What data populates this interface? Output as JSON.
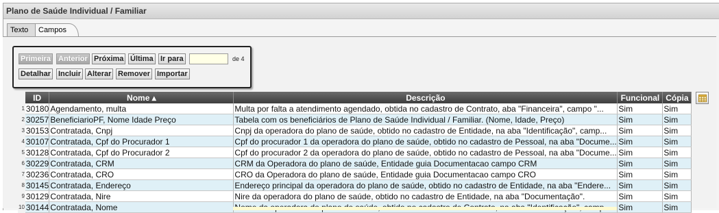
{
  "panel": {
    "title": "Plano de Saúde Individual / Familiar"
  },
  "tabs": [
    {
      "label": "Texto"
    },
    {
      "label": "Campos"
    }
  ],
  "navigation": {
    "first": "Primeira",
    "prev": "Anterior",
    "next": "Próxima",
    "last": "Última",
    "goto": "Ir para",
    "page_input_value": "",
    "page_suffix": "de 4",
    "detail": "Detalhar",
    "include": "Incluir",
    "edit": "Alterar",
    "remove": "Remover",
    "import": "Importar"
  },
  "grid": {
    "columns": {
      "id": "ID",
      "name": "Nome ▴",
      "description": "Descrição",
      "functional": "Funcional",
      "copy": "Cópia"
    },
    "rows": [
      {
        "n": "1",
        "id": "30180",
        "name": "Agendamento, multa",
        "desc": "Multa por falta a atendimento agendado, obtida no cadastro de Contrato, aba \"Financeira\", campo \"...",
        "func": "Sim",
        "copy": "Sim"
      },
      {
        "n": "2",
        "id": "30257",
        "name": "BeneficiarioPF, Nome Idade Preço",
        "desc": "Tabela com os beneficiários de Plano de Saúde Individual / Familiar. (Nome, Idade, Preço)",
        "func": "Sim",
        "copy": "Sim"
      },
      {
        "n": "3",
        "id": "30153",
        "name": "Contratada, Cnpj",
        "desc": "Cnpj da operadora do plano de saúde, obtido no cadastro de Entidade, na aba \"Identificação\", camp...",
        "func": "Sim",
        "copy": "Sim"
      },
      {
        "n": "4",
        "id": "30107",
        "name": "Contratada, Cpf do Procurador 1",
        "desc": "Cpf do procurador 1 da operadora do plano de saúde, obtido no cadastro de Pessoal, na aba \"Docume...",
        "func": "Sim",
        "copy": "Sim"
      },
      {
        "n": "5",
        "id": "30128",
        "name": "Contratada, Cpf do Procurador 2",
        "desc": "Cpf do procurador 2 da operadora do plano de saúde, obtido no cadastro de Pessoal, na aba \"Docume...",
        "func": "Sim",
        "copy": "Sim"
      },
      {
        "n": "6",
        "id": "30229",
        "name": "Contratada, CRM",
        "desc": "CRM da Operadora do plano de saúde, Entidade guia Documentacao campo CRM",
        "func": "Sim",
        "copy": "Sim"
      },
      {
        "n": "7",
        "id": "30236",
        "name": "Contratada, CRO",
        "desc": "CRO da Operadora do plano de saúde, Entidade guia Documentacao campo CRO",
        "func": "Sim",
        "copy": "Sim"
      },
      {
        "n": "8",
        "id": "30145",
        "name": "Contratada, Endereço",
        "desc": "Endereço principal da operadora do plano de saúde, obtido no cadastro de Entidade, na aba \"Endere...",
        "func": "Sim",
        "copy": "Sim"
      },
      {
        "n": "9",
        "id": "30129",
        "name": "Contratada, Nire",
        "desc": "Nire da operadora do plano de saúde, obtido no cadastro de Entidade, na aba \"Documentação\".",
        "func": "Sim",
        "copy": "Sim"
      },
      {
        "n": "10",
        "id": "30144",
        "name": "Contratada, Nome",
        "desc": "Nome da operadora do plano de saúde, obtido no cadastro de Contrato, na aba \"Identificação\", camp...",
        "func": "Sim",
        "copy": "Sim"
      }
    ]
  },
  "icons": {
    "column_chooser": "table-columns-icon"
  }
}
